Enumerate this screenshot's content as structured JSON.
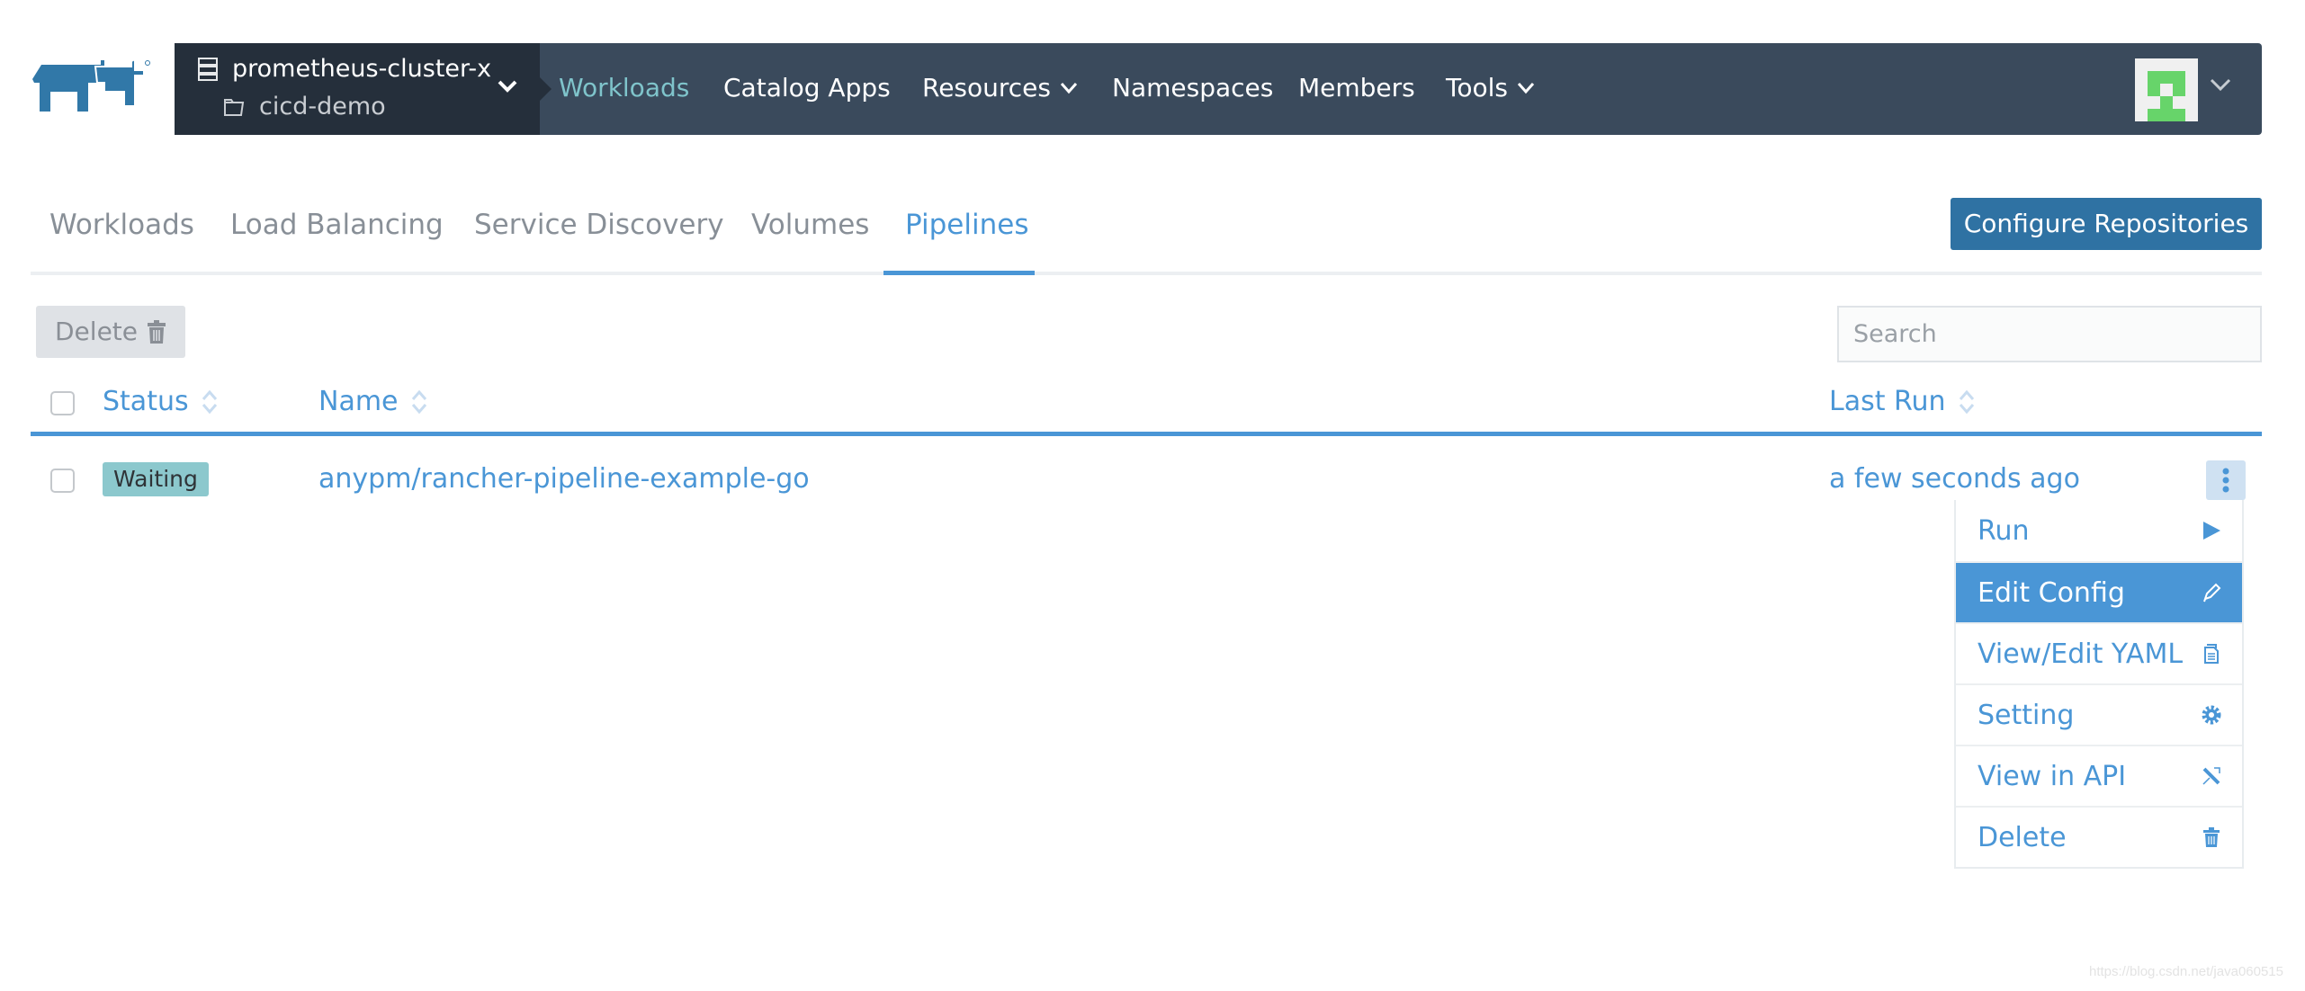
{
  "header": {
    "cluster_name": "prometheus-cluster-x",
    "project_name": "cicd-demo",
    "nav": [
      {
        "label": "Workloads",
        "active": true,
        "has_dropdown": false
      },
      {
        "label": "Catalog Apps",
        "active": false,
        "has_dropdown": false
      },
      {
        "label": "Resources",
        "active": false,
        "has_dropdown": true
      },
      {
        "label": "Namespaces",
        "active": false,
        "has_dropdown": false
      },
      {
        "label": "Members",
        "active": false,
        "has_dropdown": false
      },
      {
        "label": "Tools",
        "active": false,
        "has_dropdown": true
      }
    ]
  },
  "subtabs": [
    {
      "label": "Workloads",
      "active": false
    },
    {
      "label": "Load Balancing",
      "active": false
    },
    {
      "label": "Service Discovery",
      "active": false
    },
    {
      "label": "Volumes",
      "active": false
    },
    {
      "label": "Pipelines",
      "active": true
    }
  ],
  "toolbar": {
    "configure_label": "Configure Repositories",
    "delete_label": "Delete",
    "search_placeholder": "Search",
    "search_value": ""
  },
  "table": {
    "columns": [
      "Status",
      "Name",
      "Last Run"
    ],
    "rows": [
      {
        "status": "Waiting",
        "name": "anypm/rancher-pipeline-example-go",
        "last_run": "a few seconds ago"
      }
    ]
  },
  "action_menu": {
    "items": [
      {
        "label": "Run",
        "icon": "play-icon",
        "highlighted": false
      },
      {
        "label": "Edit Config",
        "icon": "pencil-icon",
        "highlighted": true
      },
      {
        "label": "View/Edit YAML",
        "icon": "file-icon",
        "highlighted": false
      },
      {
        "label": "Setting",
        "icon": "gear-icon",
        "highlighted": false
      },
      {
        "label": "View in API",
        "icon": "external-link-icon",
        "highlighted": false
      },
      {
        "label": "Delete",
        "icon": "trash-icon",
        "highlighted": false
      }
    ]
  },
  "colors": {
    "accent": "#4a96d6",
    "topbar": "#3a4a5c",
    "cluster_bg": "#252f3b",
    "primary_button": "#2f72a3",
    "status_waiting": "#8cc8cd",
    "avatar_green": "#67d46a"
  },
  "watermark": "https://blog.csdn.net/java060515"
}
